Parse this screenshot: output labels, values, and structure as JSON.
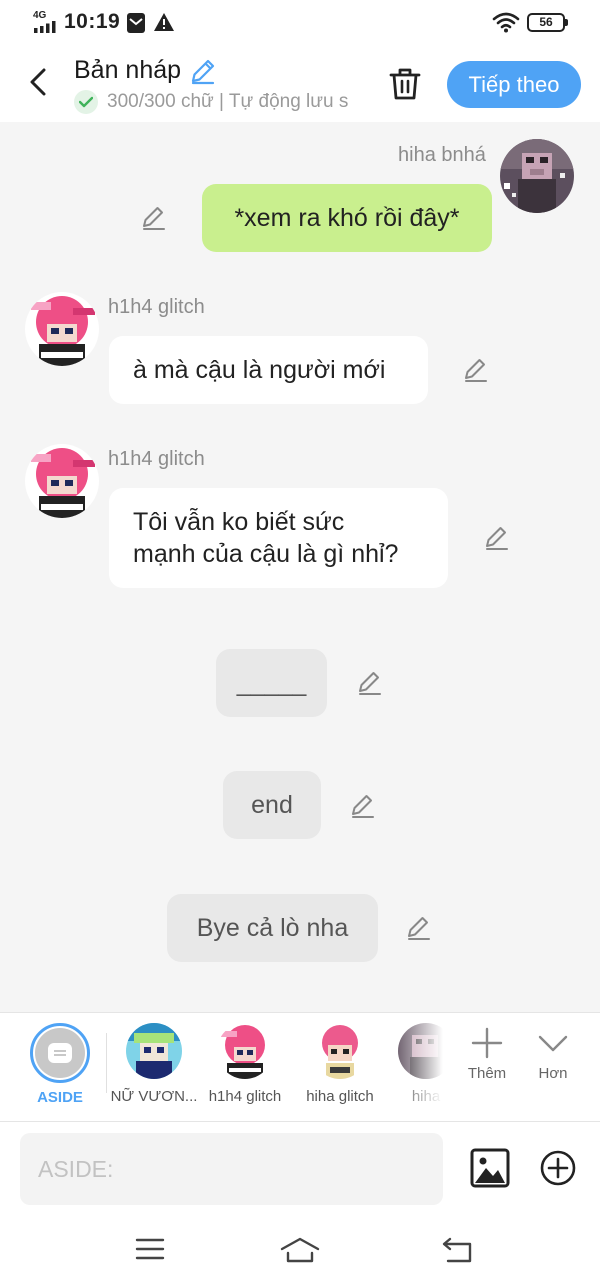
{
  "status_bar": {
    "network": "4G",
    "time": "10:19",
    "battery": "56"
  },
  "header": {
    "title": "Bản nháp",
    "subtitle": "300/300 chữ | Tự động lưu s",
    "next_label": "Tiếp theo"
  },
  "messages": [
    {
      "sender": "hiha bnhá",
      "text": "*xem ra khó rồi đây*",
      "side": "right"
    },
    {
      "sender": "h1h4 glitch",
      "text": "à mà cậu là người mới",
      "side": "left"
    },
    {
      "sender": "h1h4 glitch",
      "text_line1": "Tôi vẫn ko biết sức",
      "text_line2": "mạnh của cậu là gì nhỉ?",
      "side": "left"
    },
    {
      "text": "_____",
      "side": "aside"
    },
    {
      "text": "end",
      "side": "aside"
    },
    {
      "text": "Bye cả lò nha",
      "side": "aside"
    }
  ],
  "characters": {
    "aside_label": "ASIDE",
    "items": [
      {
        "name": "NỮ VƯƠN..."
      },
      {
        "name": "h1h4 glitch"
      },
      {
        "name": "hiha glitch"
      },
      {
        "name": "hiha"
      }
    ],
    "add_label": "Thêm",
    "more_label": "Hơn"
  },
  "composer": {
    "placeholder": "ASIDE:"
  },
  "colors": {
    "accent": "#4fa3f5",
    "my_bubble": "#c9ef8e",
    "aside_bubble": "#e8e8e8"
  }
}
